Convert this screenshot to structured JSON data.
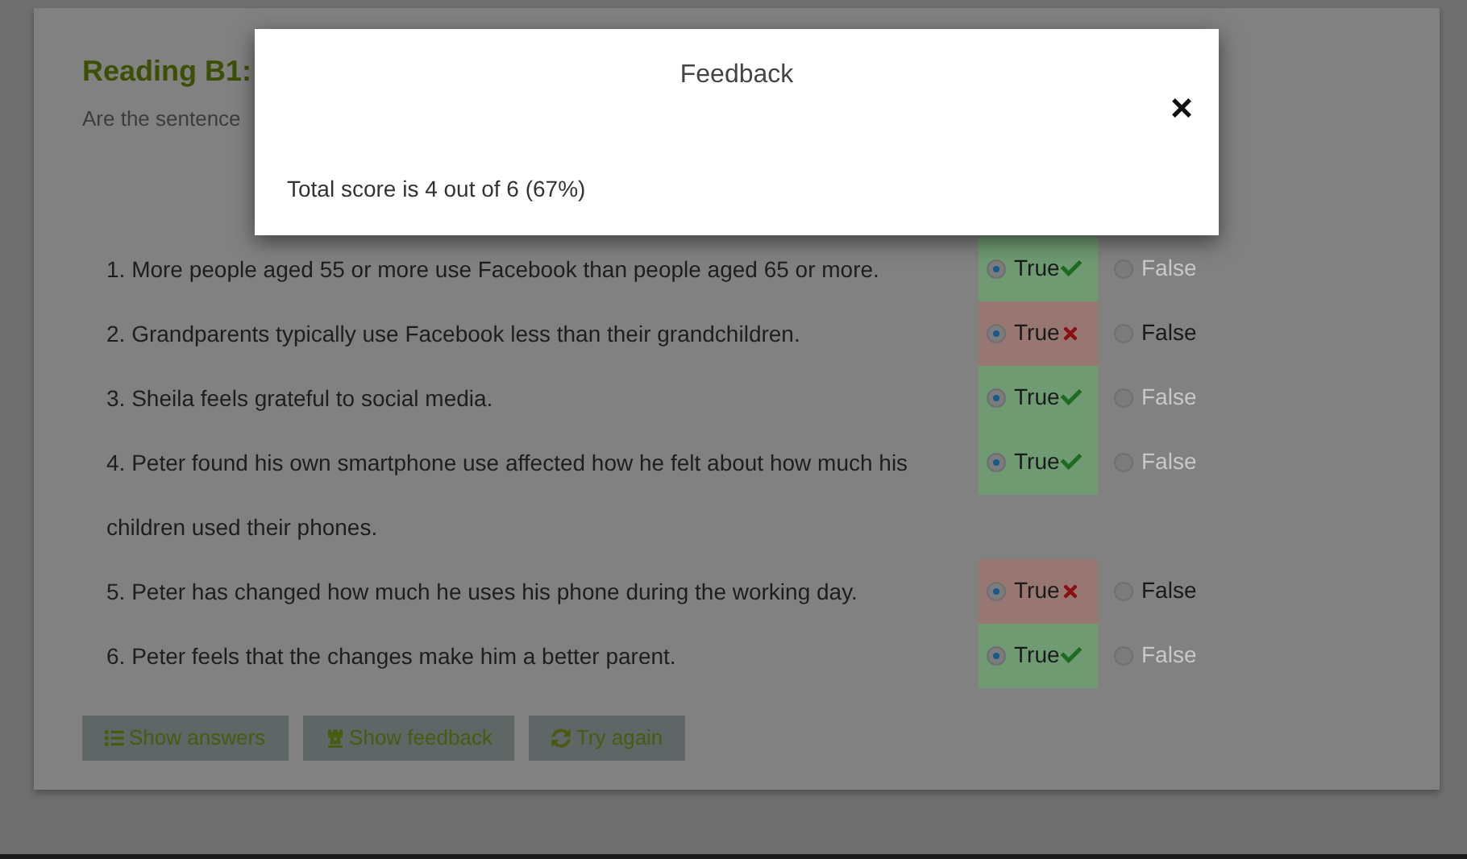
{
  "title": "Reading B1:",
  "instructions": "Are the sentence",
  "questions": [
    {
      "text": "1. More people aged 55 or more use Facebook than people aged 65 or more.",
      "correct": true,
      "options": [
        {
          "label": "True",
          "selected": true,
          "disabled": false
        },
        {
          "label": "False",
          "selected": false,
          "disabled": true
        }
      ]
    },
    {
      "text": "2. Grandparents typically use Facebook less than their grandchildren.",
      "correct": false,
      "options": [
        {
          "label": "True",
          "selected": true,
          "disabled": false
        },
        {
          "label": "False",
          "selected": false,
          "disabled": false
        }
      ]
    },
    {
      "text": "3. Sheila feels grateful to social media.",
      "correct": true,
      "options": [
        {
          "label": "True",
          "selected": true,
          "disabled": false
        },
        {
          "label": "False",
          "selected": false,
          "disabled": true
        }
      ]
    },
    {
      "text": "4. Peter found his own smartphone use affected how he felt about how much his children used their phones.",
      "correct": true,
      "options": [
        {
          "label": "True",
          "selected": true,
          "disabled": false
        },
        {
          "label": "False",
          "selected": false,
          "disabled": true
        }
      ]
    },
    {
      "text": "5. Peter has changed how much he uses his phone during the working day.",
      "correct": false,
      "options": [
        {
          "label": "True",
          "selected": true,
          "disabled": false
        },
        {
          "label": "False",
          "selected": false,
          "disabled": false
        }
      ]
    },
    {
      "text": "6. Peter feels that the changes make him a better parent.",
      "correct": true,
      "options": [
        {
          "label": "True",
          "selected": true,
          "disabled": false
        },
        {
          "label": "False",
          "selected": false,
          "disabled": true
        }
      ]
    }
  ],
  "buttons": [
    {
      "kind": "answers",
      "label": "Show answers"
    },
    {
      "kind": "feedback",
      "label": "Show feedback"
    },
    {
      "kind": "retry",
      "label": "Try again"
    }
  ],
  "modal": {
    "title": "Feedback",
    "close": "×",
    "body": "Total score is 4 out of 6 (67%)"
  }
}
